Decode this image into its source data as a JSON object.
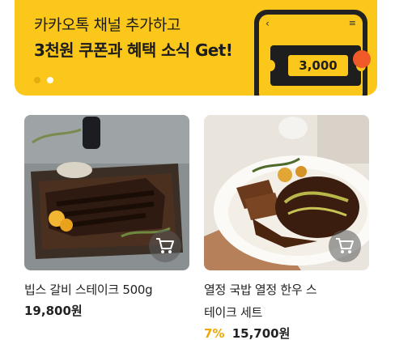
{
  "banner": {
    "line1": "카카오톡 채널 추가하고",
    "line2": "3천원 쿠폰과 혜택 소식 Get!",
    "coupon_value": "3,000",
    "phone_back_icon": "chevron-left-icon",
    "phone_menu_icon": "hamburger-icon",
    "pagination": {
      "count": 2,
      "active": 2
    },
    "colors": {
      "accent": "#fbc71a",
      "dark": "#1e1e1e",
      "badge": "#f05a28"
    }
  },
  "products": [
    {
      "name": "빕스 갈비 스테이크 500g",
      "price": "19,800원",
      "discount": "",
      "image_icon": "ribs-steak-image",
      "cart_icon": "cart-icon"
    },
    {
      "name_line1": "열정 국밥 열정 한우 스",
      "name_line2": "테이크 세트",
      "price": "15,700원",
      "discount": "7%",
      "image_icon": "hanwoo-steak-image",
      "cart_icon": "cart-icon"
    }
  ],
  "colors": {
    "discount": "#f0a800",
    "text": "#222222"
  }
}
